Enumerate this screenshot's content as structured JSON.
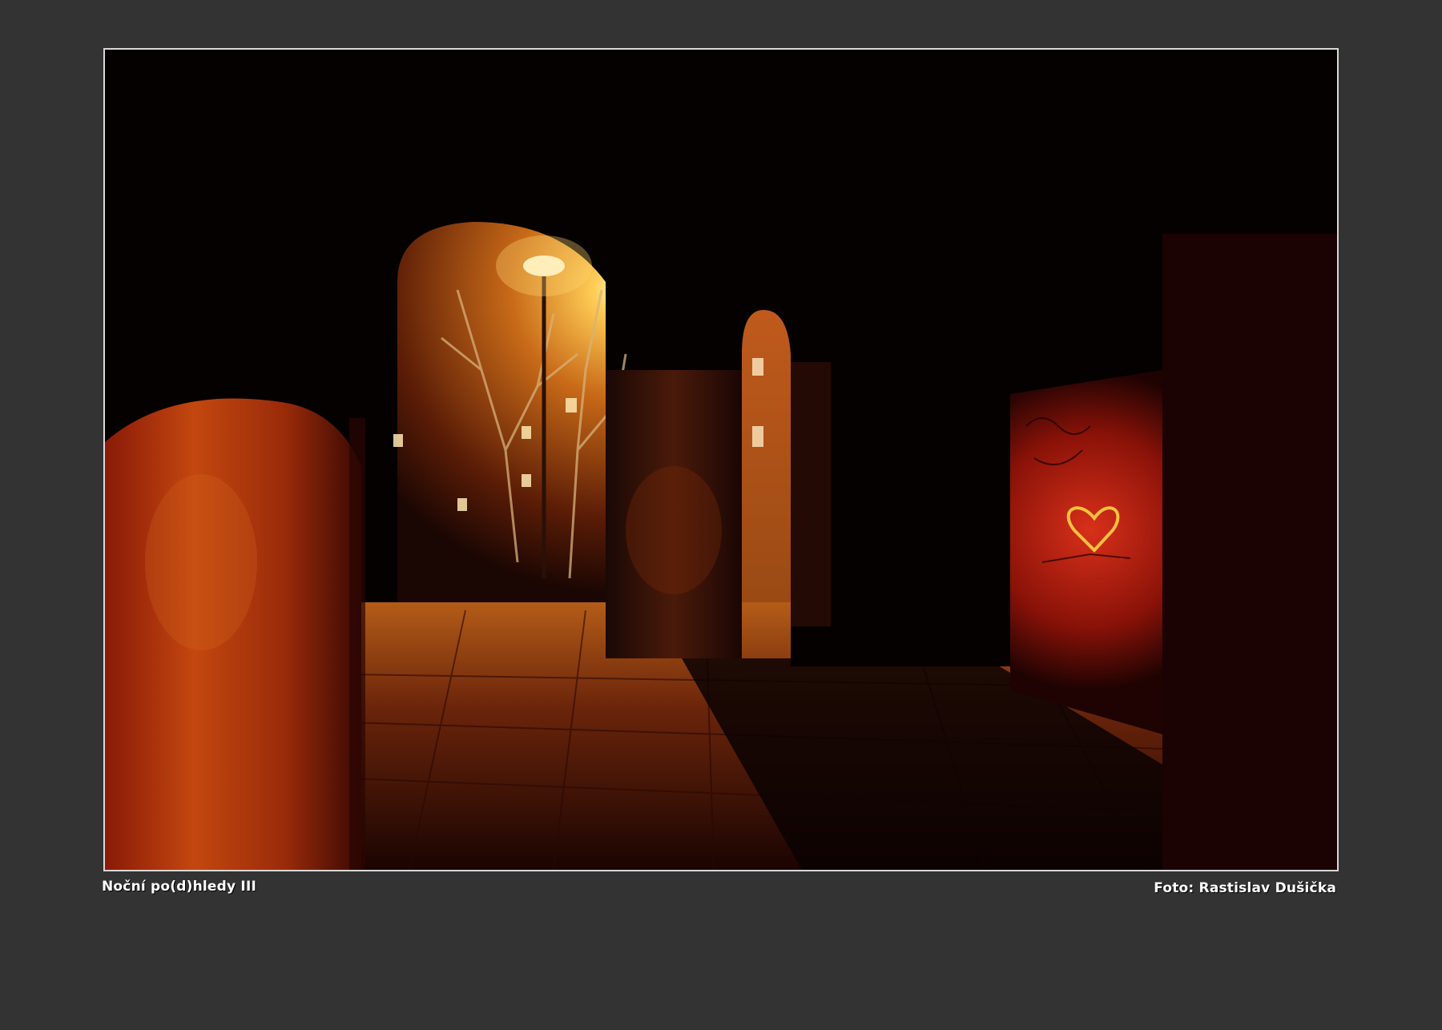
{
  "photo": {
    "scene": "night-archway"
  },
  "captions": {
    "title": "Noční po(d)hledy III",
    "credit": "Foto: Rastislav Dušička"
  },
  "colors": {
    "background": "#333333",
    "frame_border": "#d8d8d8",
    "lamp_glow": "#ffcc55",
    "wall_red": "#b8220c"
  }
}
